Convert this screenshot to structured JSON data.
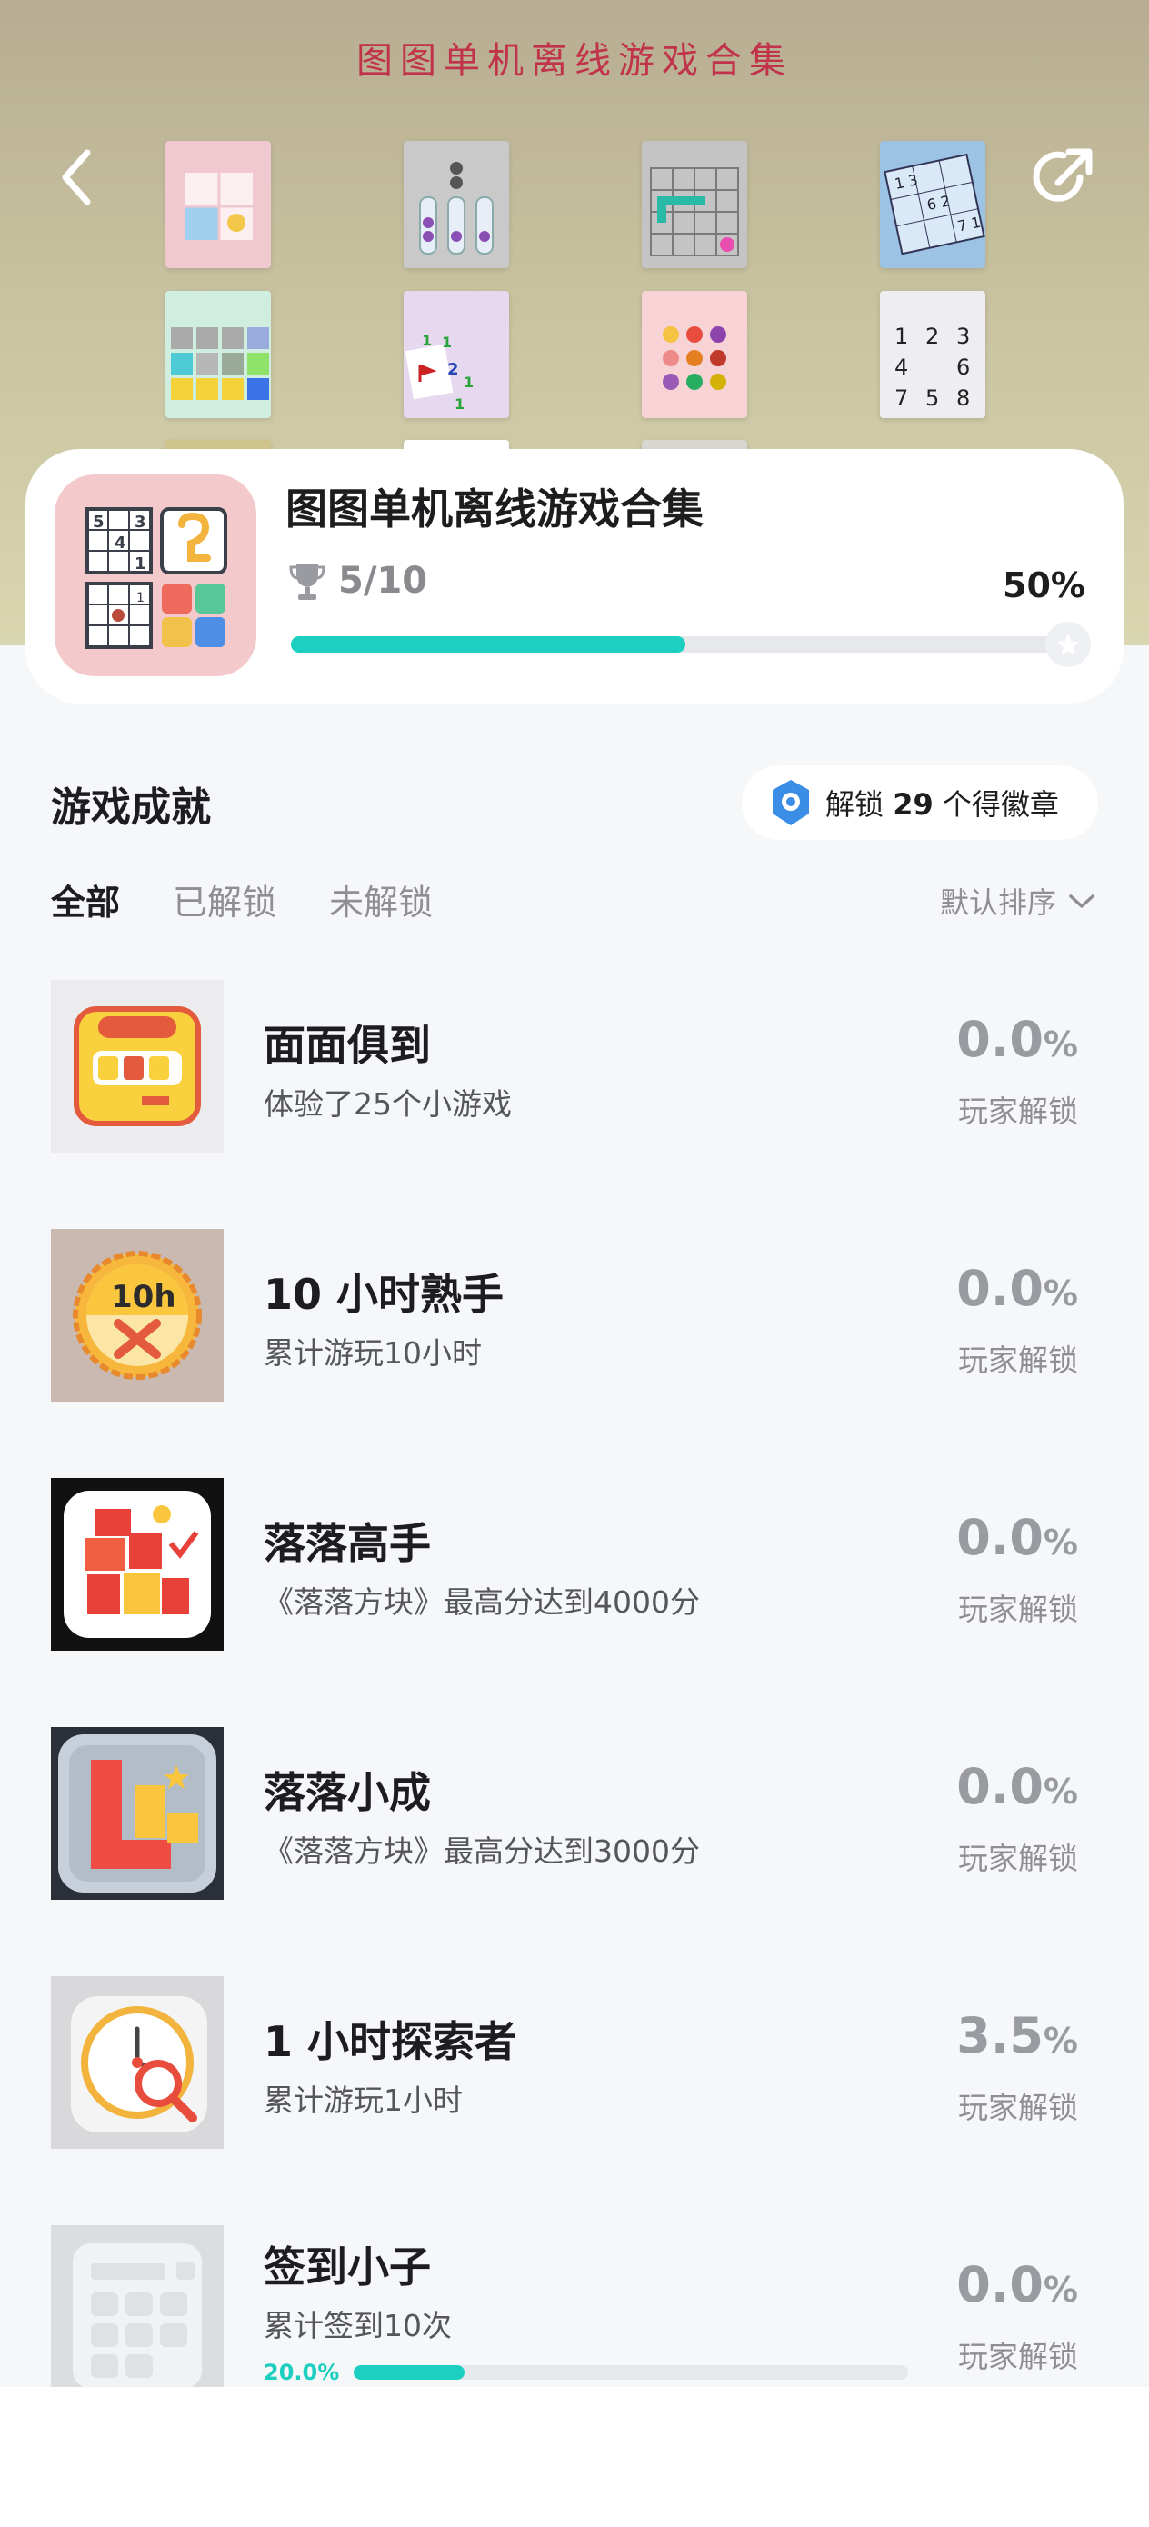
{
  "banner": {
    "title": "图图单机离线游戏合集",
    "back_icon": "chevron-left-icon",
    "share_icon": "share-icon",
    "thumb_sudoku": [
      "1",
      "2",
      "3",
      "4",
      "",
      "6",
      "7",
      "5",
      "8"
    ]
  },
  "header": {
    "title": "图图单机离线游戏合集",
    "trophy_icon": "trophy-icon",
    "achievements_count": "5/10",
    "progress_percent_label": "50%",
    "progress_value": 0.5
  },
  "section": {
    "title": "游戏成就",
    "badge_prefix": "解锁 ",
    "badge_count": "29",
    "badge_suffix": " 个得徽章"
  },
  "tabs": [
    {
      "label": "全部",
      "active": true
    },
    {
      "label": "已解锁",
      "active": false
    },
    {
      "label": "未解锁",
      "active": false
    }
  ],
  "sort": {
    "label": "默认排序"
  },
  "achievements": [
    {
      "title": "面面俱到",
      "desc": "体验了25个小游戏",
      "pct": "0.0",
      "unit": "%",
      "sub": "玩家解锁",
      "icon": "all-rounder-badge-icon"
    },
    {
      "title": "10 小时熟手",
      "desc": "累计游玩10小时",
      "pct": "0.0",
      "unit": "%",
      "sub": "玩家解锁",
      "icon": "ten-hours-badge-icon",
      "icon_text": "10h"
    },
    {
      "title": "落落高手",
      "desc": "《落落方块》最高分达到4000分",
      "pct": "0.0",
      "unit": "%",
      "sub": "玩家解锁",
      "icon": "blocks-master-icon"
    },
    {
      "title": "落落小成",
      "desc": "《落落方块》最高分达到3000分",
      "pct": "0.0",
      "unit": "%",
      "sub": "玩家解锁",
      "icon": "blocks-beginner-icon"
    },
    {
      "title": "1 小时探索者",
      "desc": "累计游玩1小时",
      "pct": "3.5",
      "unit": "%",
      "sub": "玩家解锁",
      "icon": "clock-search-icon"
    },
    {
      "title": "签到小子",
      "desc": "累计签到10次",
      "pct": "0.0",
      "unit": "%",
      "sub": "玩家解锁",
      "icon": "calendar-checkin-icon",
      "progress_label": "20.0%",
      "progress_value": 0.2
    }
  ],
  "colors": {
    "accent": "#1ccfc0",
    "banner_title": "#c0334a"
  }
}
